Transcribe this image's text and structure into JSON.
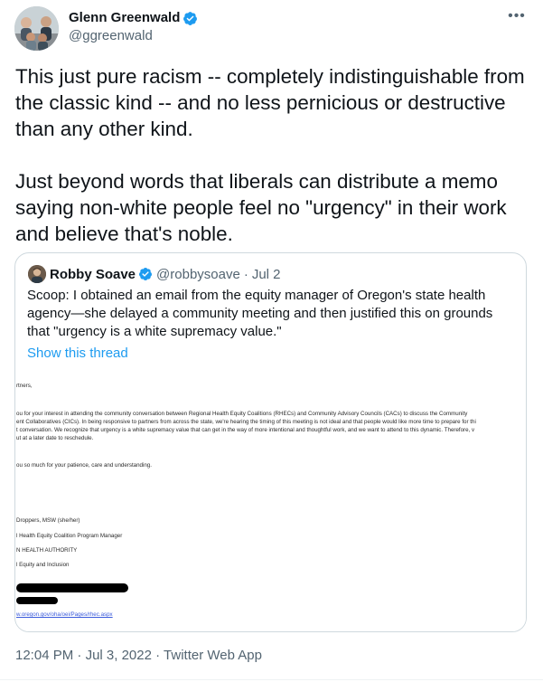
{
  "author": {
    "name": "Glenn Greenwald",
    "handle": "@ggreenwald",
    "verified_icon": "verified-badge-icon",
    "accent_color": "#1d9bf0"
  },
  "tweet": {
    "text": "This just pure racism -- completely indistinguishable from the classic kind -- and no less pernicious or destructive than any other kind.\n\nJust beyond words that liberals can distribute a memo saying non-white people feel no \"urgency\" in their work and believe that's noble."
  },
  "quoted": {
    "name": "Robby Soave",
    "handle": "@robbysoave",
    "separator": "·",
    "date": "Jul 2",
    "text": "Scoop: I obtained an email from the equity manager of Oregon's state health agency—she delayed a community meeting and then justified this on grounds that \"urgency is a white supremacy value.\"",
    "show_thread": "Show this thread",
    "memo": {
      "l1": "rtners,",
      "l2": "ou for your interest in attending the community conversation between Regional Health Equity Coalitions (RHECs) and Community Advisory Councils (CACs) to discuss the Community",
      "l3": "ent Collaboratives (CICs). In being responsive to partners from across the state, we're hearing the timing of this meeting is not ideal and that people would like more time to prepare for thi",
      "l4": "t conversation. We recognize that urgency is a white supremacy value that can get in the way of more intentional and thoughtful work, and we want to attend to this dynamic. Therefore, v",
      "l5": "ut at a later date to reschedule.",
      "l6": "ou so much for your patience, care and understanding.",
      "l7": "Droppers, MSW (she/her)",
      "l8": "l Health Equity Coalition Program Manager",
      "l9": "N HEALTH AUTHORITY",
      "l10": "l Equity and Inclusion",
      "l11": "w.oregon.gov/oha/oei/Pages/rhec.aspx"
    }
  },
  "meta": {
    "time": "12:04 PM",
    "dot": "·",
    "date": "Jul 3, 2022",
    "source": "Twitter Web App"
  }
}
